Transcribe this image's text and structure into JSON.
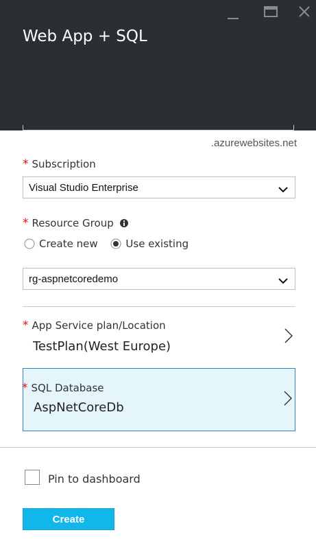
{
  "window": {
    "title": "Web App + SQL",
    "controls": [
      "minimize-icon",
      "maximize-icon",
      "close-icon"
    ]
  },
  "app_name": {
    "domain_suffix": ".azurewebsites.net"
  },
  "subscription": {
    "label": "Subscription",
    "required": "*",
    "value": "Visual Studio Enterprise"
  },
  "resource_group": {
    "label": "Resource Group",
    "required": "*",
    "options": [
      "Create new",
      "Use existing"
    ],
    "selected": "Use existing",
    "value": "rg-aspnetcoredemo"
  },
  "app_service_plan": {
    "label": "App Service plan/Location",
    "required": "*",
    "value": "TestPlan(West Europe)"
  },
  "sql_database": {
    "label": "SQL Database",
    "required": "*",
    "value": "AspNetCoreDb"
  },
  "footer": {
    "pin_label": "Pin to dashboard",
    "pin_checked": false,
    "create_label": "Create"
  },
  "colors": {
    "header_bg": "#2b2f33",
    "accent": "#12b7ea",
    "required": "#dd1111",
    "selected_bg": "#e5f5fc"
  }
}
